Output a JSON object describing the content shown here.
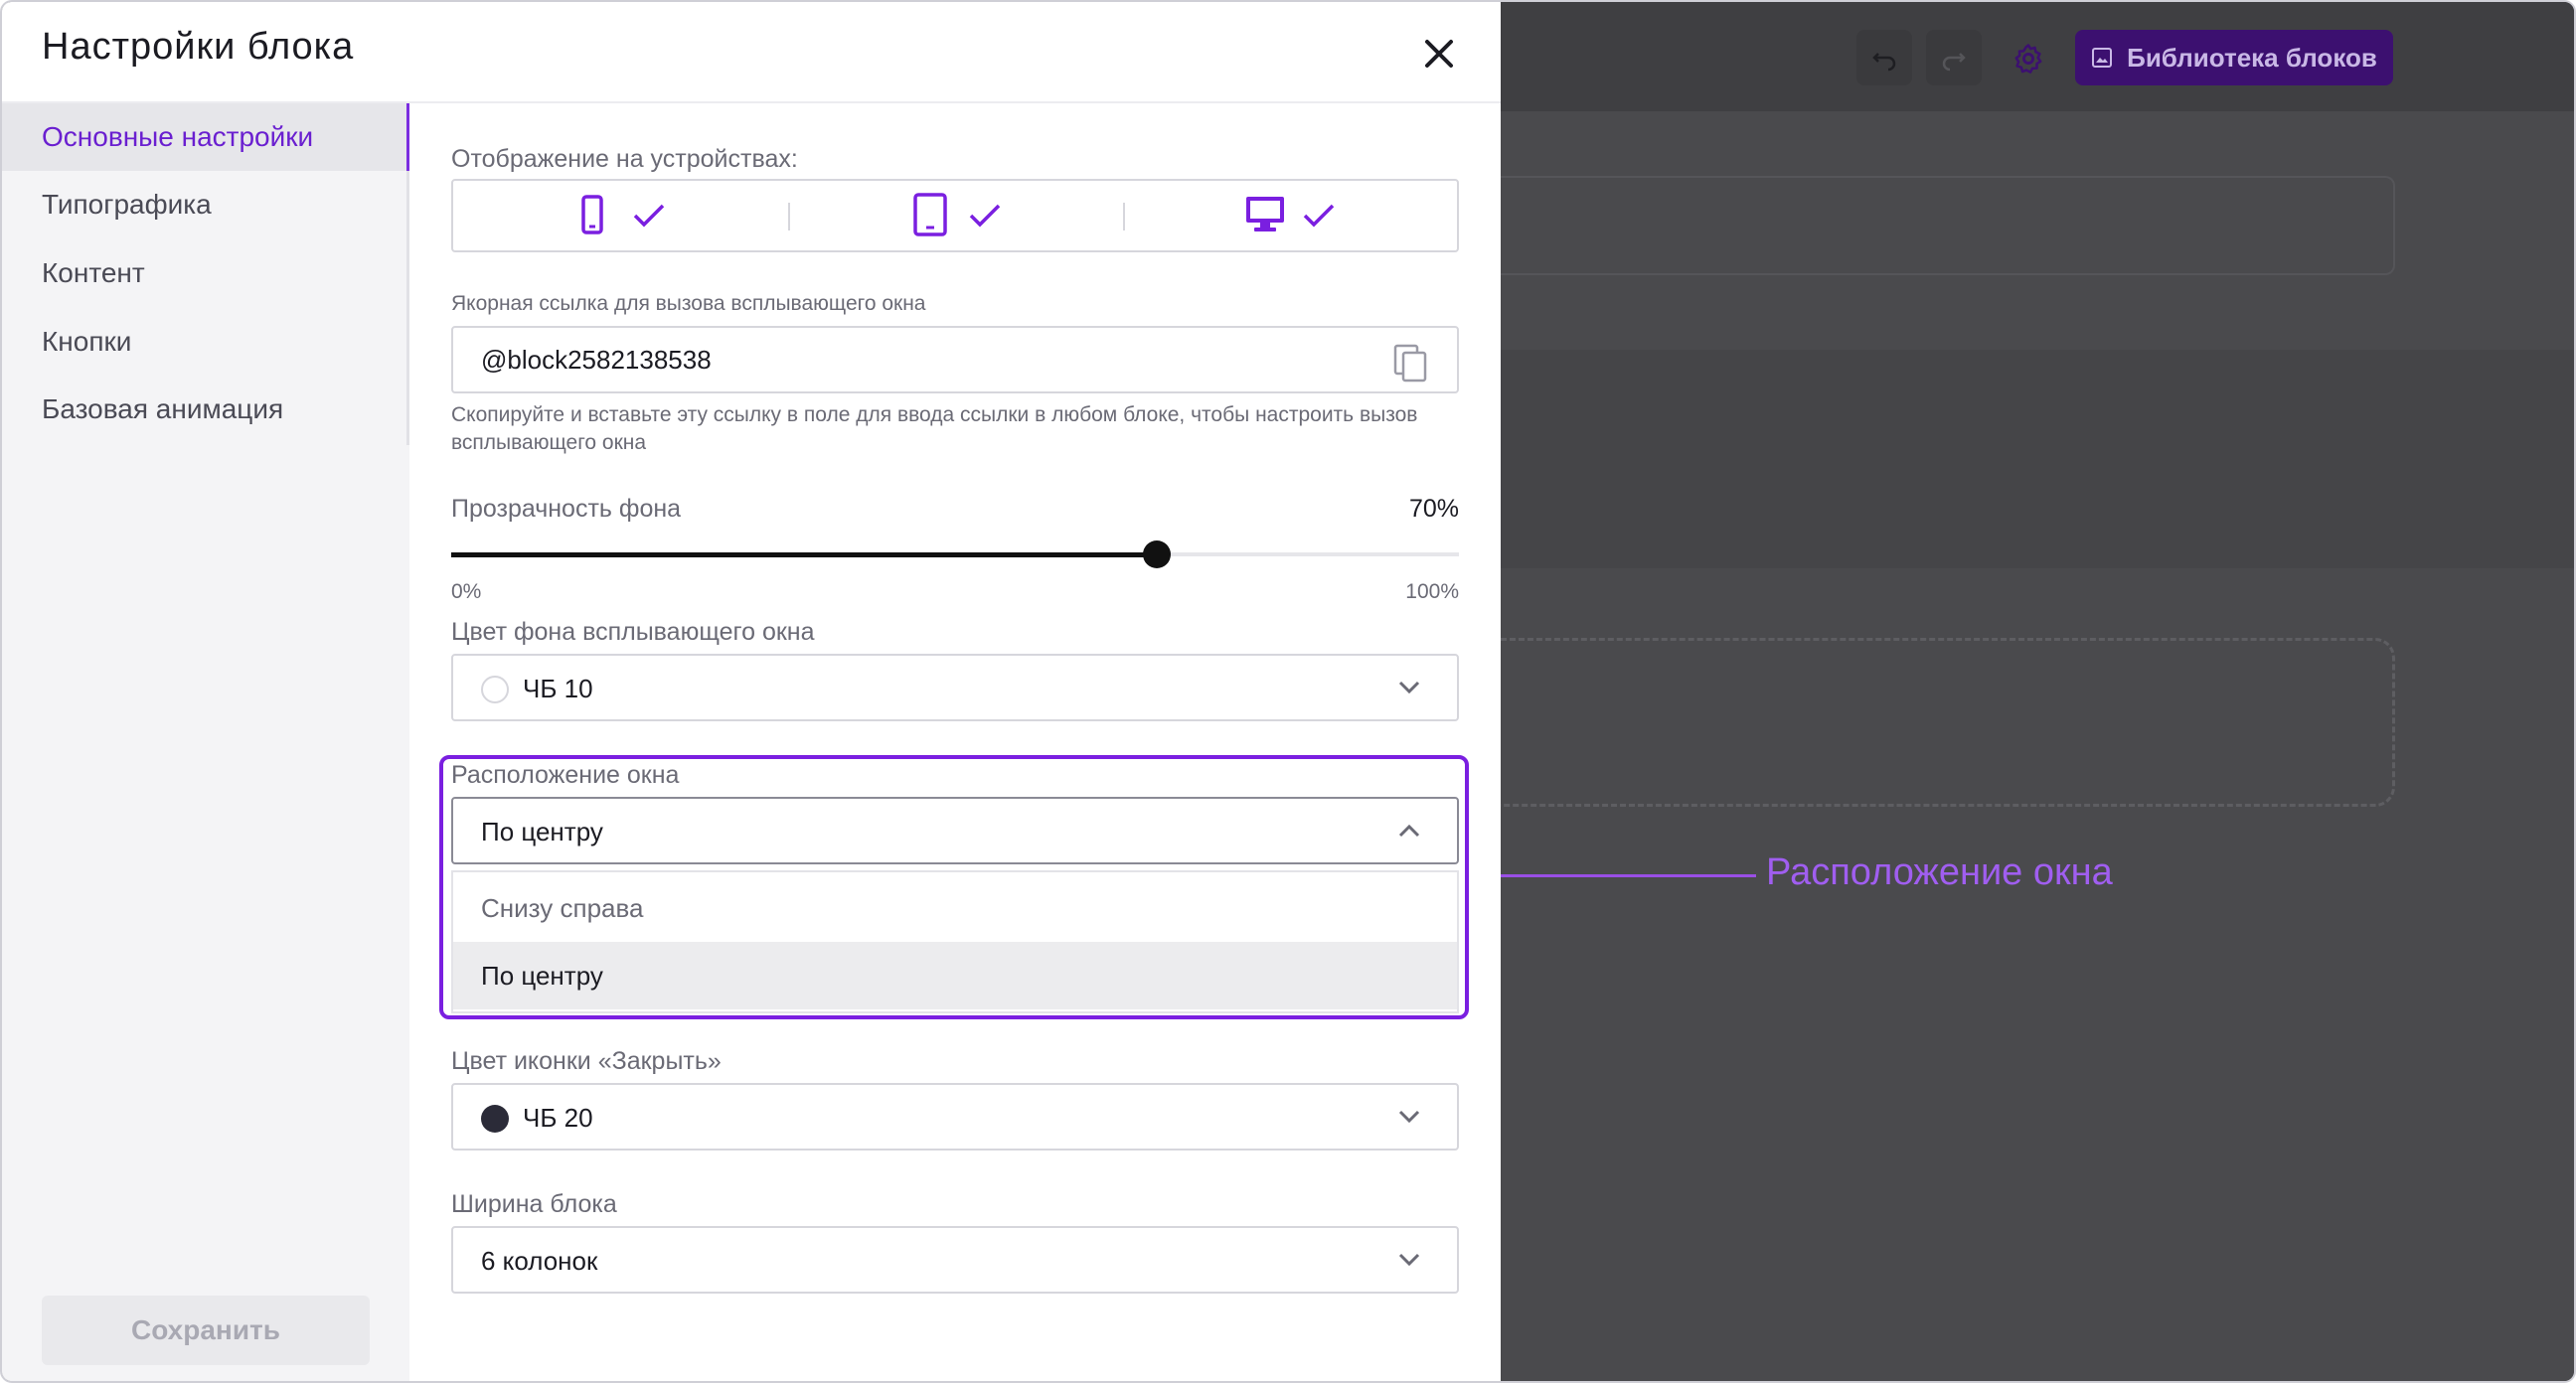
{
  "panel": {
    "title": "Настройки блока",
    "sidebar": {
      "items": [
        {
          "label": "Основные настройки",
          "active": true
        },
        {
          "label": "Типографика"
        },
        {
          "label": "Контент"
        },
        {
          "label": "Кнопки"
        },
        {
          "label": "Базовая анимация"
        }
      ],
      "save_label": "Сохранить"
    },
    "devices": {
      "label": "Отображение на устройствах:",
      "items": [
        {
          "name": "mobile",
          "icon": "smartphone-icon",
          "checked": true
        },
        {
          "name": "tablet",
          "icon": "tablet-icon",
          "checked": true
        },
        {
          "name": "desktop",
          "icon": "desktop-icon",
          "checked": true
        }
      ]
    },
    "anchor": {
      "label": "Якорная ссылка для вызова всплывающего окна",
      "value": "@block2582138538",
      "hint": "Скопируйте и вставьте эту ссылку в поле для ввода ссылки в любом блоке, чтобы настроить вызов всплывающего окна"
    },
    "opacity": {
      "label": "Прозрачность фона",
      "value_text": "70%",
      "value": 0.7,
      "min_label": "0%",
      "max_label": "100%"
    },
    "bg_color": {
      "label": "Цвет фона всплывающего окна",
      "value": "ЧБ 10",
      "swatch": "#ffffff"
    },
    "position": {
      "label": "Расположение окна",
      "value": "По центру",
      "options": [
        "Снизу справа",
        "По центру"
      ],
      "selected_index": 1
    },
    "close_icon_color": {
      "label": "Цвет иконки «Закрыть»",
      "value": "ЧБ 20",
      "swatch": "#2b2b38"
    },
    "block_width": {
      "label": "Ширина блока",
      "value": "6 колонок"
    }
  },
  "editor": {
    "library_button": "Библиотека блоков"
  },
  "annotation": {
    "text": "Расположение окна"
  },
  "colors": {
    "accent": "#7a1fe0",
    "annotation": "#a05ef0",
    "overlay": "#4a4a4d"
  }
}
